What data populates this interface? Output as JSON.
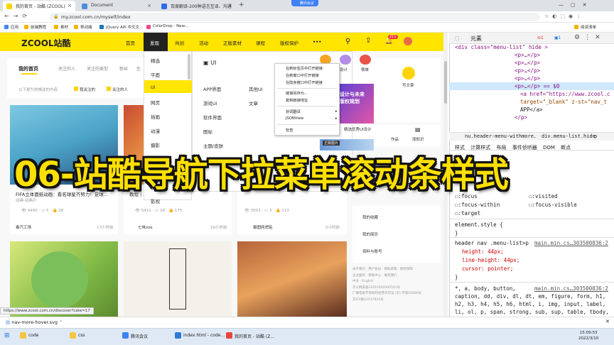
{
  "browser": {
    "tabs": [
      {
        "title": "我的首页 - 站酷 (ZCOOL)",
        "active": true
      },
      {
        "title": "Document",
        "active": false
      },
      {
        "title": "百度翻译-200种语言互译、沟通",
        "active": false
      }
    ],
    "meeting_badge": "腾讯会议",
    "url": "my.zcool.com.cn/myself/index",
    "bookmarks": [
      "应用",
      "前端教程",
      "素材",
      "移动端",
      "jQuery API 中文文...",
      "ColorDrop - New..."
    ],
    "reading_list": "阅读清单"
  },
  "site": {
    "logo": "ZCOOL站酷",
    "nav": [
      "首页",
      "发现",
      "共创",
      "活动",
      "正版素材",
      "课程",
      "版权保护"
    ],
    "nav_more": "•••",
    "badge": "211",
    "sub_tabs": [
      "我的首页",
      "关注的人",
      "关注的类型",
      "粉丝",
      "生"
    ],
    "filter_hint": "以下是为你推送的内容",
    "filters": [
      "我关注的",
      "关注的人",
      "关注的..."
    ],
    "dropdown_left": [
      "精选",
      "平面",
      "UI",
      "网页",
      "插画",
      "动漫",
      "摄影",
      "三维",
      "影视"
    ],
    "dropdown_right": {
      "header": "UI",
      "col1": [
        "APP界面",
        "游戏UI",
        "软件界面",
        "图标",
        "主题/皮肤"
      ],
      "col2": [
        "其他UI",
        "文章"
      ],
      "promo_caption": "精选优秀UI设计",
      "promo_text": "设计与未来 版权规划",
      "promo2": "正版图片",
      "icons": [
        "设计师",
        "设计",
        "榜单"
      ]
    },
    "context_menu": [
      "在新标签页中打开链接",
      "在新窗口中打开链接",
      "在隐身窗口中打开链接",
      "链接另存为...",
      "复制链接地址",
      "划词翻译",
      "JSONView",
      "检查"
    ],
    "right_widgets": {
      "write_article": "写文章",
      "my_collect": "我的收藏",
      "my_resume": "我的简历",
      "account": "资料与账号",
      "learn": "涨知识",
      "item1": "作品"
    },
    "cards": [
      {
        "title": "FIFA立体面纸动画：看名球星齐努力！足球...",
        "tag": "动画-动画片",
        "views": "4490",
        "comments": "5",
        "likes": "28",
        "author": "毒汽工场",
        "time": "17小时前"
      },
      {
        "title": "教程丨A...",
        "tag": "",
        "views": "5411",
        "comments": "18",
        "likes": "175",
        "author": "七味zoe",
        "time": "20小时前"
      },
      {
        "title": "",
        "tag": "",
        "views": "3053",
        "comments": "3",
        "likes": "113",
        "author": "摄图网虎贴",
        "time": "5小时前"
      }
    ],
    "footer_links": [
      "关于我们 · 用户协议 · 隐私政策 · 授权保障",
      "企业服务 · 帮助中心 · 联系我们",
      "中文 · English",
      "京公网安备11010502000501号",
      "广播电视节目制作经营许可证 (京) 字第05690号",
      "京ICP备11017824号"
    ],
    "status_url": "https://www.zcool.com.cn/discover?cate=17"
  },
  "overlay_title": "06-站酷导航下拉菜单滚动条样式",
  "devtools": {
    "tabs": [
      "元素"
    ],
    "error_count": "1",
    "info_count": "1",
    "dom": [
      "<div class=\"menu-list\" hide >",
      "<p>…</p>",
      "<p>…</p>",
      "<p>…</p>",
      "<p>…</p>",
      "<p>…</p> == $0",
      "<a href=\"https://www.zcool.c",
      "target=\"_blank\" z-st=\"nav_t",
      "APP</a>",
      "</p>"
    ],
    "breadcrumb": [
      "nu.header-menu-withmore.",
      "div.menu-list.hide",
      "p"
    ],
    "panels": [
      "样式",
      "计算样式",
      "布局",
      "事件侦听器",
      "DOM 断点"
    ],
    "states": [
      ":focus",
      ":focus-within",
      ":target",
      ":visited",
      ":focus-visible"
    ],
    "element_style": "element.style {",
    "rule_selector": "header nav .menu-list>p",
    "rule_source": "main.min.cs…303500836:2",
    "rule_props": [
      "height: 44px;",
      "line-height: 44px;",
      "cursor: pointer;"
    ],
    "rule2_selector": "*, a, body, button,",
    "rule2_lines": [
      "caption, dd, div, dl, dt, em, figure, form, h1,",
      "h2, h3, h4, h5, h6, html, i, img, input, label,",
      "li, ol, p, span, strong, sub, sup, table, tbody,"
    ]
  },
  "download": {
    "file": "nav-more-hover.svg"
  },
  "taskbar": {
    "items": [
      "code",
      "css",
      "腾讯会议",
      "index.html - code...",
      "我的首页 - 站酷 (Z..."
    ],
    "time": "15:09:53",
    "date": "2022/3/10"
  }
}
